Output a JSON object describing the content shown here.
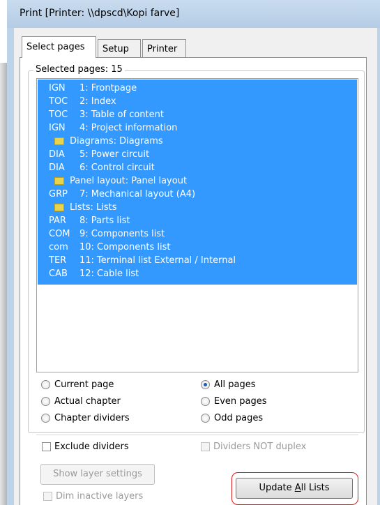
{
  "window": {
    "title": "Print [Printer: \\\\dpscd\\Kopi farve]"
  },
  "tabs": [
    {
      "label": "Select pages",
      "active": true
    },
    {
      "label": "Setup",
      "active": false
    },
    {
      "label": "Printer",
      "active": false
    }
  ],
  "group": {
    "legend": "Selected pages: 15"
  },
  "pages": [
    {
      "code": "IGN",
      "label": "1: Frontpage"
    },
    {
      "code": "TOC",
      "label": "2: Index"
    },
    {
      "code": "TOC",
      "label": "3: Table of content"
    },
    {
      "code": "IGN",
      "label": "4: Project information"
    },
    {
      "code": "",
      "label": "Diagrams: Diagrams",
      "icon": "folder-icon"
    },
    {
      "code": "DIA",
      "label": "5: Power circuit"
    },
    {
      "code": "DIA",
      "label": "6: Control circuit"
    },
    {
      "code": "",
      "label": "Panel layout: Panel layout",
      "icon": "folder-icon"
    },
    {
      "code": "GRP",
      "label": "7: Mechanical layout (A4)"
    },
    {
      "code": "",
      "label": "Lists: Lists",
      "icon": "folder-icon"
    },
    {
      "code": "PAR",
      "label": "8: Parts list"
    },
    {
      "code": "COM",
      "label": "9: Components list"
    },
    {
      "code": "com",
      "label": "10: Components list"
    },
    {
      "code": "TER",
      "label": "11: Terminal list External / Internal"
    },
    {
      "code": "CAB",
      "label": "12: Cable list"
    }
  ],
  "range_options": [
    {
      "label": "Current page",
      "selected": false
    },
    {
      "label": "Actual chapter",
      "selected": false
    },
    {
      "label": "Chapter dividers",
      "selected": false
    },
    {
      "label": "All pages",
      "selected": true
    },
    {
      "label": "Even pages",
      "selected": false
    },
    {
      "label": "Odd pages",
      "selected": false
    }
  ],
  "options": {
    "exclude_dividers": "Exclude dividers",
    "dividers_not_duplex": "Dividers NOT duplex",
    "dim_inactive_layers": "Dim inactive layers"
  },
  "buttons": {
    "show_layer_settings": "Show layer settings",
    "update_all_lists_prefix": "Update ",
    "update_all_lists_accel": "A",
    "update_all_lists_suffix": "ll Lists"
  },
  "colors": {
    "selection": "#3399ff",
    "title_bar": "#b9cfe8",
    "highlight_ring": "#d81818",
    "folder": "#e7d44c"
  }
}
